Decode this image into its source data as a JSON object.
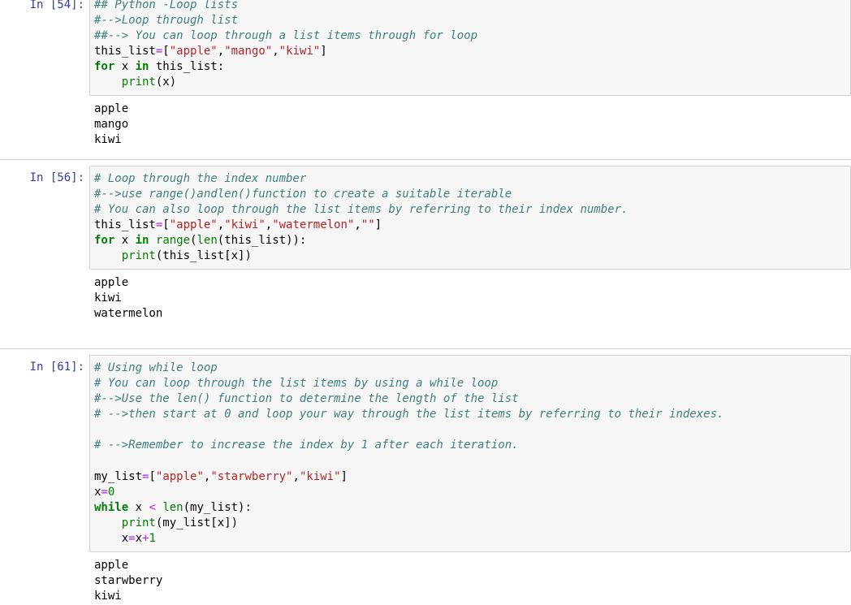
{
  "cells": [
    {
      "prompt": "In [54]:",
      "code": [
        [
          {
            "t": "c",
            "v": "## Python -Loop lists"
          }
        ],
        [
          {
            "t": "c",
            "v": "#-->Loop through list"
          }
        ],
        [
          {
            "t": "c",
            "v": "##--> You can loop through a list items through for loop"
          }
        ],
        [
          {
            "t": "n",
            "v": "this_list"
          },
          {
            "t": "o",
            "v": "="
          },
          {
            "t": "p",
            "v": "["
          },
          {
            "t": "s",
            "v": "\"apple\""
          },
          {
            "t": "p",
            "v": ","
          },
          {
            "t": "s",
            "v": "\"mango\""
          },
          {
            "t": "p",
            "v": ","
          },
          {
            "t": "s",
            "v": "\"kiwi\""
          },
          {
            "t": "p",
            "v": "]"
          }
        ],
        [
          {
            "t": "k",
            "v": "for"
          },
          {
            "t": "n",
            "v": " x "
          },
          {
            "t": "k",
            "v": "in"
          },
          {
            "t": "n",
            "v": " this_list:"
          }
        ],
        [
          {
            "t": "n",
            "v": "    "
          },
          {
            "t": "b",
            "v": "print"
          },
          {
            "t": "p",
            "v": "(x)"
          }
        ]
      ],
      "output": [
        "apple",
        "mango",
        "kiwi"
      ]
    },
    {
      "prompt": "In [56]:",
      "code": [
        [
          {
            "t": "c",
            "v": "# Loop through the index number"
          }
        ],
        [
          {
            "t": "c",
            "v": "#-->use range()andlen()function to create a suitable iterable"
          }
        ],
        [
          {
            "t": "c",
            "v": "# You can also loop through the list items by referring to their index number."
          }
        ],
        [
          {
            "t": "n",
            "v": "this_list"
          },
          {
            "t": "o",
            "v": "="
          },
          {
            "t": "p",
            "v": "["
          },
          {
            "t": "s",
            "v": "\"apple\""
          },
          {
            "t": "p",
            "v": ","
          },
          {
            "t": "s",
            "v": "\"kiwi\""
          },
          {
            "t": "p",
            "v": ","
          },
          {
            "t": "s",
            "v": "\"watermelon\""
          },
          {
            "t": "p",
            "v": ","
          },
          {
            "t": "s",
            "v": "\"\""
          },
          {
            "t": "p",
            "v": "]"
          }
        ],
        [
          {
            "t": "k",
            "v": "for"
          },
          {
            "t": "n",
            "v": " x "
          },
          {
            "t": "k",
            "v": "in"
          },
          {
            "t": "n",
            "v": " "
          },
          {
            "t": "b",
            "v": "range"
          },
          {
            "t": "p",
            "v": "("
          },
          {
            "t": "b",
            "v": "len"
          },
          {
            "t": "p",
            "v": "(this_list)):"
          }
        ],
        [
          {
            "t": "n",
            "v": "    "
          },
          {
            "t": "b",
            "v": "print"
          },
          {
            "t": "p",
            "v": "(this_list[x])"
          }
        ]
      ],
      "output": [
        "apple",
        "kiwi",
        "watermelon"
      ]
    },
    {
      "prompt": "In [61]:",
      "code": [
        [
          {
            "t": "c",
            "v": "# Using while loop"
          }
        ],
        [
          {
            "t": "c",
            "v": "# You can loop through the list items by using a while loop"
          }
        ],
        [
          {
            "t": "c",
            "v": "#-->Use the len() function to determine the length of the list"
          }
        ],
        [
          {
            "t": "c",
            "v": "# -->then start at 0 and loop your way through the list items by referring to their indexes."
          }
        ],
        [],
        [
          {
            "t": "c",
            "v": "# -->Remember to increase the index by 1 after each iteration."
          }
        ],
        [],
        [
          {
            "t": "n",
            "v": "my_list"
          },
          {
            "t": "o",
            "v": "="
          },
          {
            "t": "p",
            "v": "["
          },
          {
            "t": "s",
            "v": "\"apple\""
          },
          {
            "t": "p",
            "v": ","
          },
          {
            "t": "s",
            "v": "\"starwberry\""
          },
          {
            "t": "p",
            "v": ","
          },
          {
            "t": "s",
            "v": "\"kiwi\""
          },
          {
            "t": "p",
            "v": "]"
          }
        ],
        [
          {
            "t": "n",
            "v": "x"
          },
          {
            "t": "o",
            "v": "="
          },
          {
            "t": "num",
            "v": "0"
          }
        ],
        [
          {
            "t": "k",
            "v": "while"
          },
          {
            "t": "n",
            "v": " x "
          },
          {
            "t": "o",
            "v": "<"
          },
          {
            "t": "n",
            "v": " "
          },
          {
            "t": "b",
            "v": "len"
          },
          {
            "t": "p",
            "v": "(my_list):"
          }
        ],
        [
          {
            "t": "n",
            "v": "    "
          },
          {
            "t": "b",
            "v": "print"
          },
          {
            "t": "p",
            "v": "(my_list[x])"
          }
        ],
        [
          {
            "t": "n",
            "v": "    x"
          },
          {
            "t": "o",
            "v": "="
          },
          {
            "t": "n",
            "v": "x"
          },
          {
            "t": "o",
            "v": "+"
          },
          {
            "t": "num",
            "v": "1"
          }
        ]
      ],
      "output": [
        "apple",
        "starwberry",
        "kiwi"
      ]
    }
  ]
}
